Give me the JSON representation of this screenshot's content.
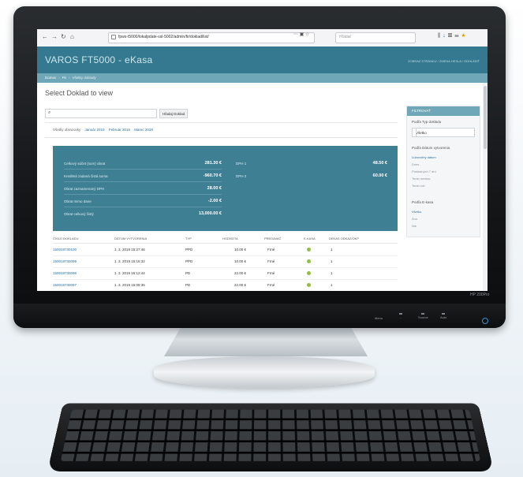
{
  "device": {
    "brand_label": "HP 200Pro",
    "controls": [
      {
        "label": "Menu"
      },
      {
        "label": "-"
      },
      {
        "label": "Source"
      },
      {
        "label": "Auto"
      }
    ]
  },
  "browser": {
    "url": "fpws-t5000/lokalpdate-ssl-5002/admin/fir/doklad/list/",
    "search_placeholder": "Hľadať"
  },
  "app": {
    "title": "VAROS FT5000 - eKasa",
    "user_links": "ZOBRAZ STRÁNKU / ZMENA HESLA / ODHLÁSIŤ"
  },
  "breadcrumb": {
    "home": "Domov",
    "section": "Fir",
    "current": "Všetky doklady"
  },
  "page": {
    "title": "Select Doklad to view"
  },
  "search": {
    "button_label": "Hľadaj Doklad"
  },
  "month_filter": {
    "label": "Všetky obrazovky",
    "months": [
      "Január 2019",
      "Február 2019",
      "Marec 2019"
    ]
  },
  "summary": {
    "rows": [
      {
        "label": "Celkový súčet (sum) obrat",
        "value": "281.30 €"
      },
      {
        "label": "Kreditná zadaná čistá suma",
        "value": "-960.70 €"
      },
      {
        "label": "Obrat zaznamenaný DPH",
        "value": "28.00 €"
      },
      {
        "label": "Obrat mimo dane",
        "value": "-2.00 €"
      },
      {
        "label": "Obrat celkový čistý",
        "value": "13,000.00 €"
      }
    ],
    "dph": [
      {
        "label": "DPH 1",
        "value": "48.50 €"
      },
      {
        "label": "DPH 2",
        "value": "60.00 €"
      }
    ]
  },
  "table": {
    "headers": [
      "ČÍSLO DOKLADU",
      "DÁTUM VYTVORENIA",
      "TYP",
      "HODNOTA",
      "PREDAVAČ",
      "E-KASA",
      "DEKAS ODKAZ/OKP"
    ],
    "rows": [
      [
        "150019730100",
        "1. 3. 2019 15:27:46",
        "PPD",
        "10.00 €",
        "Frné",
        "",
        "1"
      ],
      [
        "150019730099",
        "1. 3. 2019 15:15:32",
        "PPD",
        "10.00 €",
        "Frné",
        "",
        "1"
      ],
      [
        "150019730098",
        "1. 3. 2019 15:12:44",
        "PD",
        "22.00 €",
        "Frné",
        "",
        "1"
      ],
      [
        "150019730097",
        "1. 3. 2019 15:09:36",
        "PD",
        "22.00 €",
        "Frné",
        "",
        "1"
      ]
    ]
  },
  "sidebar": {
    "header": "FILTROVAŤ",
    "type_label": "Podľa Typ dokladu",
    "type_value": "Všetko",
    "date_label": "Podľa Dátum vytvorenia",
    "date_options": [
      "Ľubovoľný dátum",
      "Dnes",
      "Posledných 7 dní",
      "Tento mesiac",
      "Tento rok"
    ],
    "ekasa_label": "Podľa E-kasa",
    "ekasa_options": [
      "Všetko",
      "Áno",
      "Nie"
    ]
  }
}
